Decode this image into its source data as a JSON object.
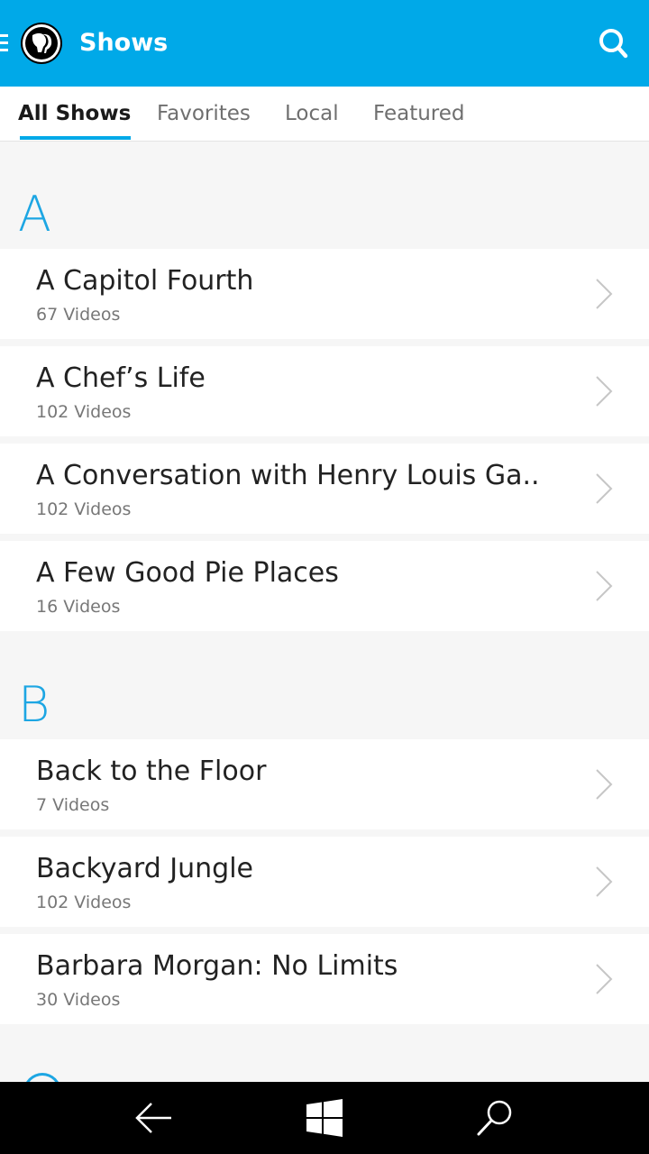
{
  "app": {
    "title": "Shows",
    "accent": "#00a9e8"
  },
  "header": {
    "menu_icon": "hamburger-icon",
    "logo": "pbs-logo",
    "search_icon": "search-icon"
  },
  "tabs": [
    {
      "label": "All Shows",
      "active": true
    },
    {
      "label": "Favorites",
      "active": false
    },
    {
      "label": "Local",
      "active": false
    },
    {
      "label": "Featured",
      "active": false
    }
  ],
  "sections": [
    {
      "letter": "A",
      "items": [
        {
          "title": "A Capitol Fourth",
          "count": "67 Videos"
        },
        {
          "title": "A Chef’s Life",
          "count": "102 Videos"
        },
        {
          "title": "A Conversation with Henry Louis Ga..",
          "count": "102 Videos"
        },
        {
          "title": "A Few Good Pie Places",
          "count": "16 Videos"
        }
      ]
    },
    {
      "letter": "B",
      "items": [
        {
          "title": "Back to the Floor",
          "count": "7 Videos"
        },
        {
          "title": "Backyard Jungle",
          "count": "102 Videos"
        },
        {
          "title": "Barbara Morgan: No Limits",
          "count": "30 Videos"
        }
      ]
    }
  ],
  "system_nav": {
    "back_icon": "back-arrow-icon",
    "home_icon": "windows-logo-icon",
    "search_icon": "search-icon"
  }
}
